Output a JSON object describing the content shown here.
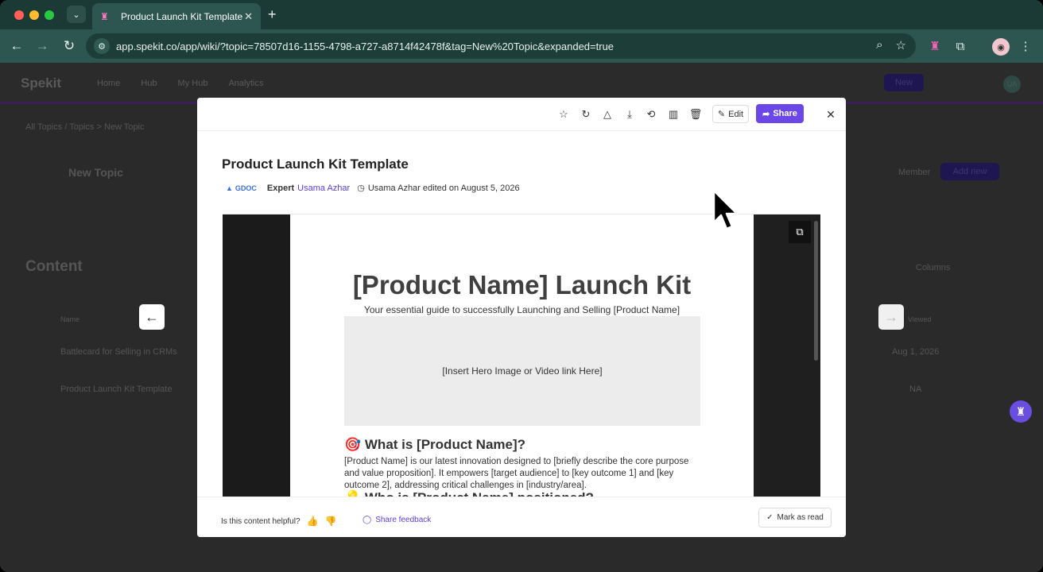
{
  "browser": {
    "tab_title": "Product Launch Kit Template",
    "tab_close": "✕",
    "new_tab": "+",
    "url": "app.spekit.co/app/wiki/?topic=78507d16-1155-4798-a727-a8714f42478f&tag=New%20Topic&expanded=true",
    "icons": [
      "back-icon",
      "forward-icon",
      "reload-icon",
      "tune-icon",
      "zoom-icon",
      "star-icon",
      "spekit-extension-icon",
      "puzzle-icon",
      "profile-avatar",
      "kebab-icon"
    ]
  },
  "background_app": {
    "logo": "Spekit",
    "nav": [
      "Home",
      "Hub",
      "My Hub",
      "Analytics"
    ],
    "new_button": "New",
    "avatar": "UA",
    "breadcrumb": "All Topics / Topics  >  New Topic",
    "topic_title": "New Topic",
    "content_heading": "Content",
    "columns_label": "Columns",
    "add_button": "Add new",
    "share_label": "Member",
    "table_header_name": "Name",
    "table_header_viewed": "Viewed",
    "rows": [
      {
        "name": "Battlecard for Selling in CRMs",
        "value": "Aug 1, 2026"
      },
      {
        "name": "Product Launch Kit Template",
        "value": "NA"
      }
    ]
  },
  "modal": {
    "toolbar_icons": [
      "star-icon",
      "sync-icon",
      "drive-icon",
      "download-icon",
      "history-icon",
      "analytics-icon",
      "trash-icon"
    ],
    "edit_label": "Edit",
    "share_label": "Share",
    "close_label": "✕",
    "title": "Product Launch Kit Template",
    "source_badge": "GDOC",
    "expert_label": "Expert",
    "expert_name": "Usama Azhar",
    "edited_text": "Usama Azhar edited on August 5, 2026",
    "document": {
      "title": "[Product Name] Launch Kit",
      "subtitle": "Your essential guide to successfully Launching and Selling [Product Name]",
      "hero_placeholder": "[Insert Hero Image or Video link Here]",
      "section1_heading": "🎯 What is [Product Name]?",
      "section1_body": "[Product Name] is our latest innovation designed to [briefly describe the core purpose and value proposition]. It empowers [target audience] to [key outcome 1] and [key outcome 2], addressing critical challenges in [industry/area].",
      "section2_heading": "💡 Who is [Product Name] positioned?"
    },
    "helpful_question": "Is this content helpful?",
    "feedback_label": "Share feedback",
    "mark_read_label": "Mark as read"
  }
}
